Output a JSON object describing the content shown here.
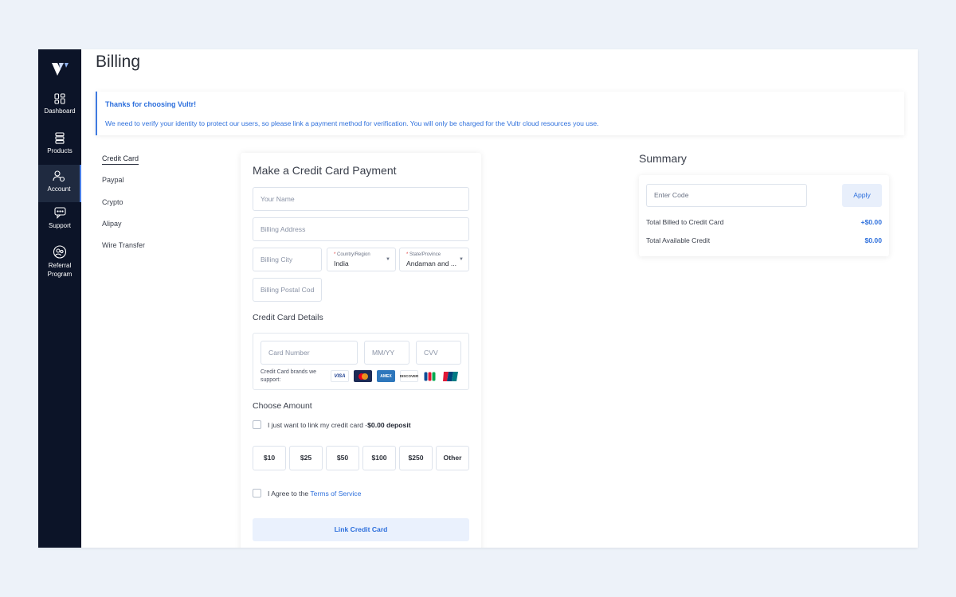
{
  "page": {
    "title": "Billing"
  },
  "sidebar": {
    "items": [
      {
        "label": "Dashboard",
        "icon": "dashboard-icon"
      },
      {
        "label": "Products",
        "icon": "products-icon"
      },
      {
        "label": "Account",
        "icon": "account-icon",
        "active": true
      },
      {
        "label": "Support",
        "icon": "support-icon"
      },
      {
        "label": "Referral",
        "label2": "Program",
        "icon": "referral-icon"
      }
    ]
  },
  "notice": {
    "title": "Thanks for choosing Vultr!",
    "text": "We need to verify your identity to protect our users, so please link a payment method for verification. You will only be charged for the Vultr cloud resources you use."
  },
  "payment_methods": [
    "Credit Card",
    "Paypal",
    "Crypto",
    "Alipay",
    "Wire Transfer"
  ],
  "form": {
    "title": "Make a Credit Card Payment",
    "name_placeholder": "Your Name",
    "address_placeholder": "Billing Address",
    "city_placeholder": "Billing City",
    "country_label": "Country/Region",
    "country_value": "India",
    "state_label": "State/Province",
    "state_value": "Andaman and ...",
    "postal_placeholder": "Billing Postal Cod",
    "cc_section_title": "Credit Card Details",
    "card_number_placeholder": "Card Number",
    "expiry_placeholder": "MM/YY",
    "cvv_placeholder": "CVV",
    "brands_text": "Credit Card brands we support:",
    "brands": [
      {
        "name": "VISA",
        "icon": "visa-icon"
      },
      {
        "name": "MC",
        "icon": "mastercard-icon"
      },
      {
        "name": "AMEX",
        "icon": "amex-icon"
      },
      {
        "name": "DISCOVER",
        "icon": "discover-icon"
      },
      {
        "name": "JCB",
        "icon": "jcb-icon"
      },
      {
        "name": "UP",
        "icon": "unionpay-icon"
      }
    ],
    "amount_section_title": "Choose Amount",
    "link_only_text": "I just want to link my credit card -",
    "link_only_bold": "$0.00 deposit",
    "amounts": [
      "$10",
      "$25",
      "$50",
      "$100",
      "$250",
      "Other"
    ],
    "agree_text": "I Agree to the ",
    "agree_link": "Terms of Service",
    "submit_label": "Link Credit Card"
  },
  "summary": {
    "title": "Summary",
    "code_placeholder": "Enter Code",
    "apply_label": "Apply",
    "billed_label": "Total Billed to Credit Card",
    "billed_value": "+$0.00",
    "credit_label": "Total Available Credit",
    "credit_value": "$0.00"
  },
  "colors": {
    "accent": "#2d6fdc",
    "sidebar_bg": "#0c1428",
    "page_bg": "#edf2f9"
  }
}
